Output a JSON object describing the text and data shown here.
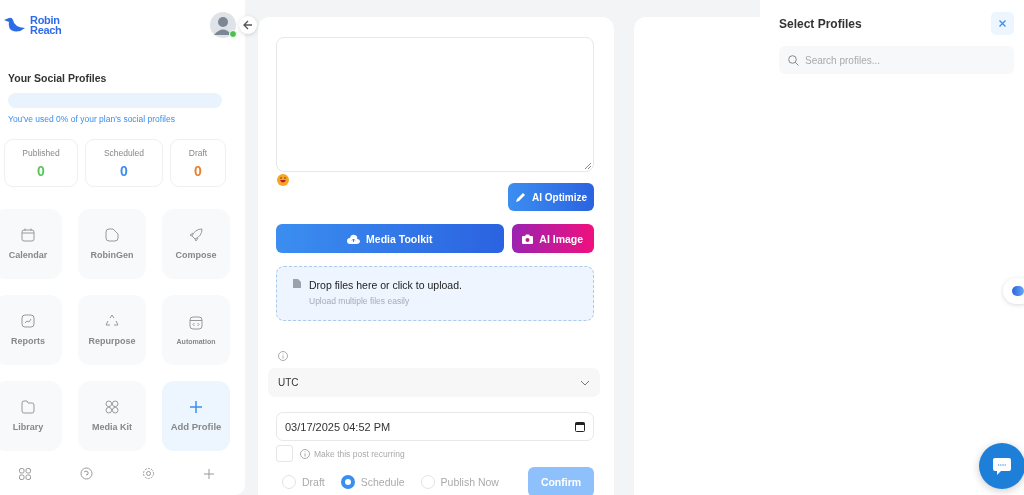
{
  "sidebar": {
    "logo": [
      "Robin",
      "Reach"
    ],
    "online": true,
    "profiles_title": "Your Social Profiles",
    "usage": {
      "level": 0,
      "text": "You've used 0% of your plan's social profiles"
    },
    "stats": [
      {
        "label": "Published",
        "value": "0",
        "color": "#5cc45c"
      },
      {
        "label": "Scheduled",
        "value": "0",
        "color": "#3b8ef0"
      },
      {
        "label": "Draft",
        "value": "0",
        "color": "#e8812f"
      }
    ],
    "tiles": [
      {
        "label": "Calendar",
        "kind": "app"
      },
      {
        "label": "RobinGen",
        "kind": "app"
      },
      {
        "label": "Compose",
        "kind": "app"
      },
      {
        "label": "Reports",
        "kind": "app"
      },
      {
        "label": "Repurpose",
        "kind": "app"
      },
      {
        "label": "Automation",
        "kind": "small"
      },
      {
        "label": "Library",
        "kind": "app"
      },
      {
        "label": "Media Kit",
        "kind": "app"
      },
      {
        "label": "Add Profile",
        "kind": "add"
      }
    ]
  },
  "composer": {
    "ai_optimize": "AI Optimize",
    "media_toolkit": "Media Toolkit",
    "ai_image": "AI Image",
    "dropzone": {
      "title": "Drop files here or click to upload.",
      "subtitle": "Upload multiple files easily"
    },
    "timezone": "UTC",
    "datetime": "03/17/2025 04:52 PM",
    "recurring": {
      "checked": false,
      "label": "Make this post recurring"
    },
    "modes": [
      {
        "label": "Draft",
        "selected": false
      },
      {
        "label": "Schedule",
        "selected": true
      },
      {
        "label": "Publish Now",
        "selected": false
      }
    ],
    "confirm": {
      "label": "Confirm",
      "disabled": true
    }
  },
  "profiles_panel": {
    "title": "Select Profiles",
    "search": {
      "placeholder": "Search profiles..."
    }
  }
}
